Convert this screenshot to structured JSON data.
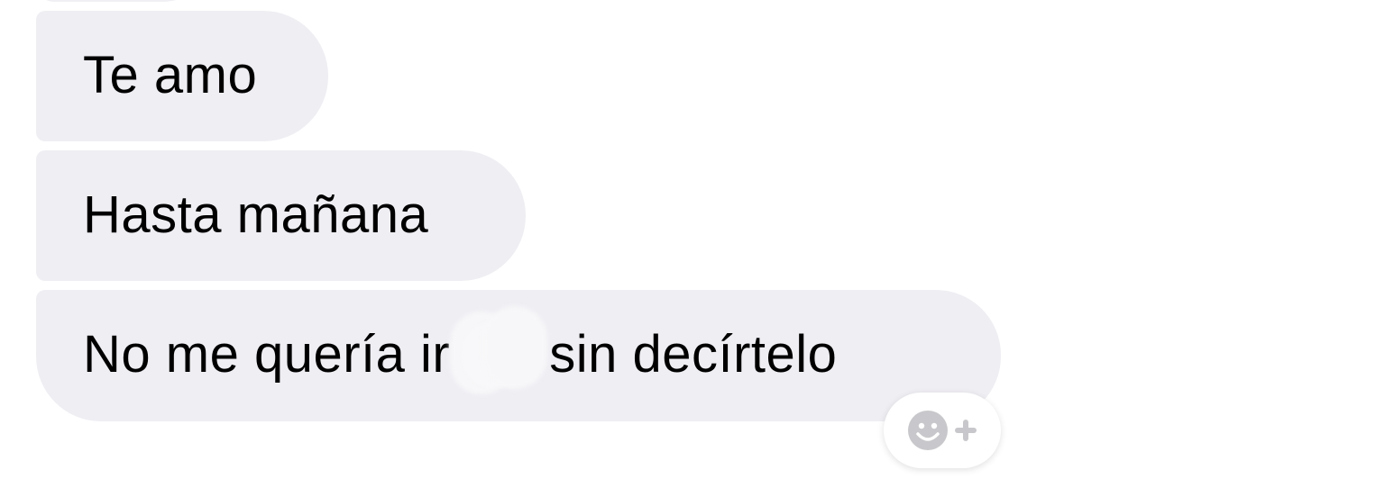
{
  "conversation": {
    "messages": [
      {
        "segments": [
          "Te amo"
        ]
      },
      {
        "segments": [
          "Hasta mañana"
        ]
      },
      {
        "segments": [
          "No me quería ir",
          "sin decírtelo"
        ],
        "redacted": true
      }
    ]
  },
  "reaction_button": {
    "icon": "smiley-plus-icon"
  },
  "colors": {
    "bubble_background": "#efeef3",
    "text": "#000000",
    "icon_gray": "#c8c8cc",
    "page_background": "#ffffff"
  }
}
